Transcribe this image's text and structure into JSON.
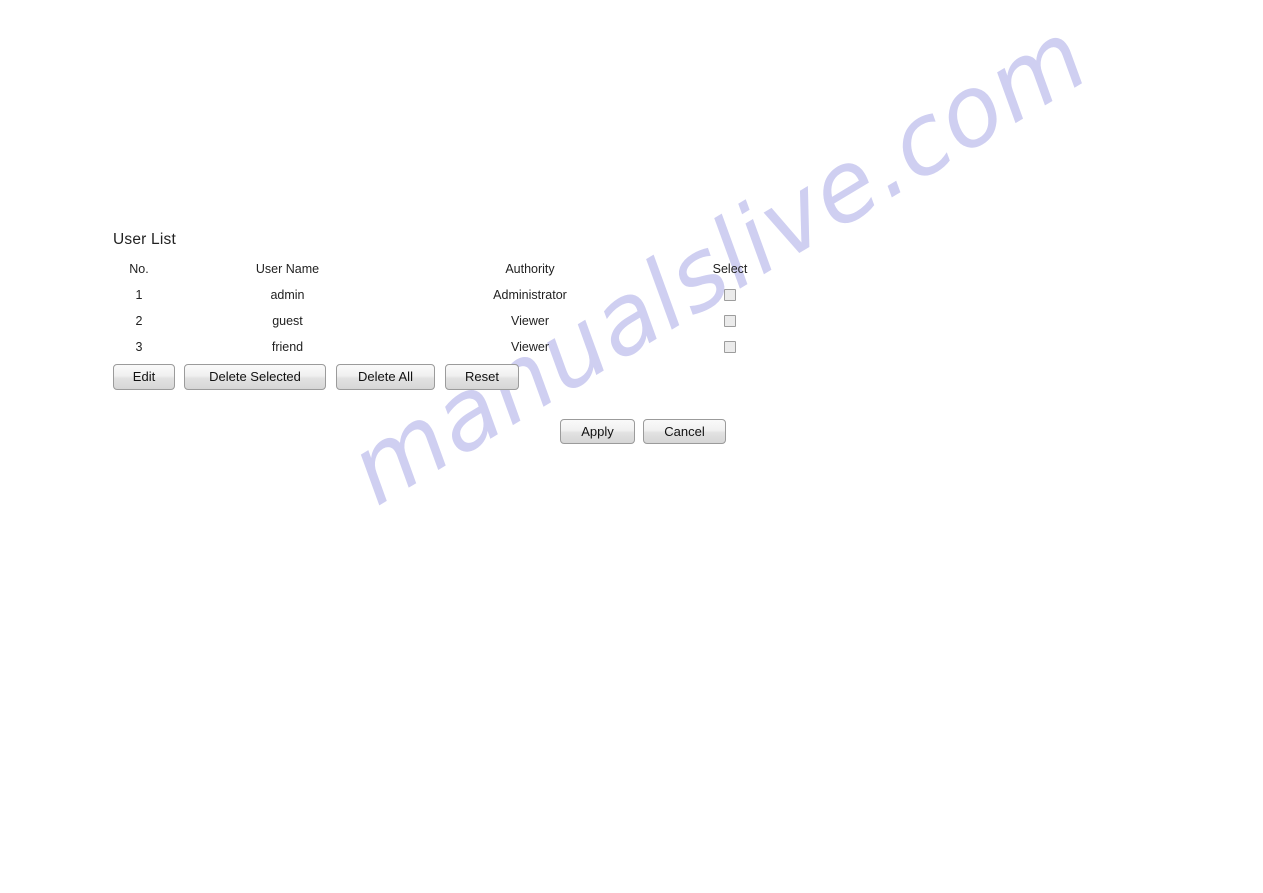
{
  "page": {
    "title": "User List",
    "background_color": "#ffffff",
    "text_color": "#222222"
  },
  "watermark": {
    "text": "manualslive.com",
    "color": "#cbcbf0",
    "rotation_deg": -31
  },
  "table": {
    "columns": [
      {
        "key": "no",
        "label": "No."
      },
      {
        "key": "user_name",
        "label": "User Name"
      },
      {
        "key": "authority",
        "label": "Authority"
      },
      {
        "key": "select",
        "label": "Select"
      }
    ],
    "rows": [
      {
        "no": "1",
        "user_name": "admin",
        "authority": "Administrator",
        "selected": false
      },
      {
        "no": "2",
        "user_name": "guest",
        "authority": "Viewer",
        "selected": false
      },
      {
        "no": "3",
        "user_name": "friend",
        "authority": "Viewer",
        "selected": false
      }
    ]
  },
  "actions": {
    "edit": "Edit",
    "delete_selected": "Delete Selected",
    "delete_all": "Delete All",
    "reset": "Reset"
  },
  "form_actions": {
    "apply": "Apply",
    "cancel": "Cancel"
  }
}
